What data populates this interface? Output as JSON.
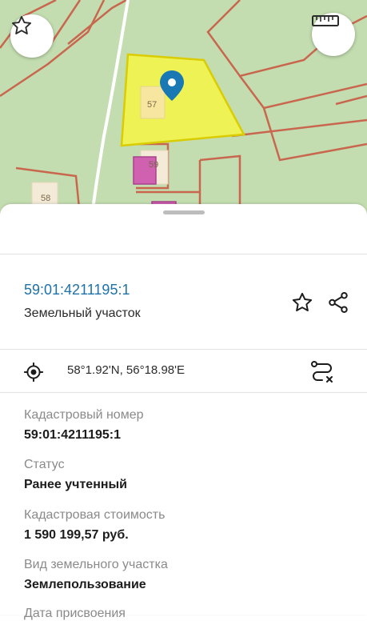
{
  "map": {
    "parcel_labels": [
      "57",
      "59",
      "58"
    ]
  },
  "buttons": {
    "favorite_icon": "star-outline",
    "ruler_icon": "ruler"
  },
  "object": {
    "cadastral_link": "59:01:4211195:1",
    "type": "Земельный участок"
  },
  "location": {
    "coordinates": "58°1.92'N, 56°18.98'E"
  },
  "details": [
    {
      "label": "Кадастровый номер",
      "value": "59:01:4211195:1"
    },
    {
      "label": "Статус",
      "value": "Ранее учтенный"
    },
    {
      "label": "Кадастровая стоимость",
      "value": "1 590 199,57 руб."
    },
    {
      "label": "Вид земельного участка",
      "value": "Землепользование"
    },
    {
      "label": "Дата присвоения",
      "value": ""
    }
  ],
  "colors": {
    "link": "#1f72a8",
    "parcel_fill": "#f0f250",
    "parcel_border": "#d9cc00",
    "boundary": "#c9674e",
    "pin": "#1a78b5"
  }
}
